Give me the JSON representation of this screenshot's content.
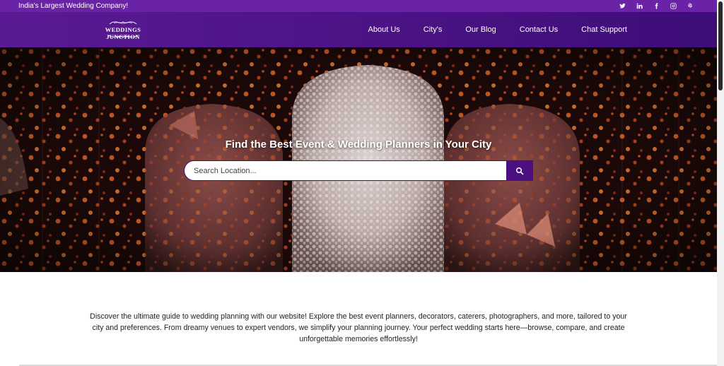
{
  "topbar": {
    "tagline": "India's Largest Wedding Company!",
    "socials": [
      "twitter-icon",
      "linkedin-icon",
      "facebook-icon",
      "instagram-icon",
      "pinterest-icon"
    ]
  },
  "brand": {
    "logo_text": "WEDDINGS JUNCTION"
  },
  "nav": {
    "items": [
      "About Us",
      "City's",
      "Our Blog",
      "Contact Us",
      "Chat Support"
    ]
  },
  "hero": {
    "title": "Find the Best Event & Wedding Planners in Your City",
    "search_placeholder": "Search Location...",
    "search_button_icon": "search-icon"
  },
  "intro": {
    "text": "Discover the ultimate guide to wedding planning with our website! Explore the best event planners, decorators, caterers, photographers, and more, tailored to your city and preferences. From dreamy venues to expert vendors, we simplify your planning journey. Your perfect wedding starts here—browse, compare, and create unforgettable memories effortlessly!"
  },
  "colors": {
    "topbar": "#6a23a6",
    "navbar": "#4a1283",
    "search_button": "#4b0f80"
  }
}
